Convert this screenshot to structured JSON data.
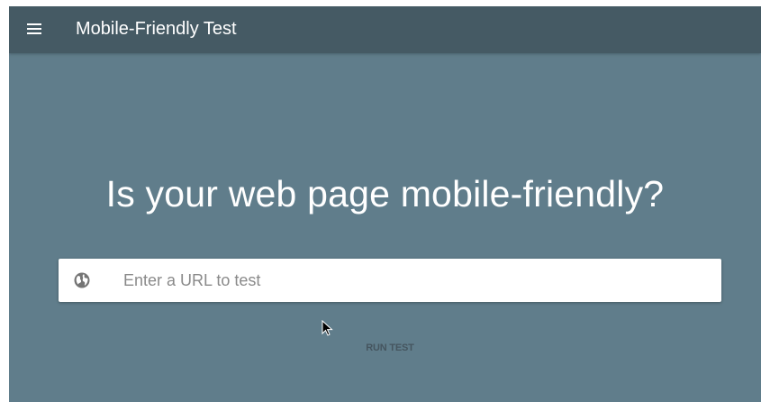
{
  "appbar": {
    "menu_icon": "hamburger-menu-icon",
    "title": "Mobile-Friendly Test"
  },
  "main": {
    "headline": "Is your web page mobile-friendly?",
    "url_input": {
      "icon": "globe-icon",
      "placeholder": "Enter a URL to test",
      "value": ""
    },
    "run_button_label": "RUN TEST"
  },
  "colors": {
    "appbar": "#455a64",
    "background": "#607d8b",
    "input_background": "#ffffff",
    "headline_text": "#ffffff",
    "button_text": "#45555f"
  }
}
